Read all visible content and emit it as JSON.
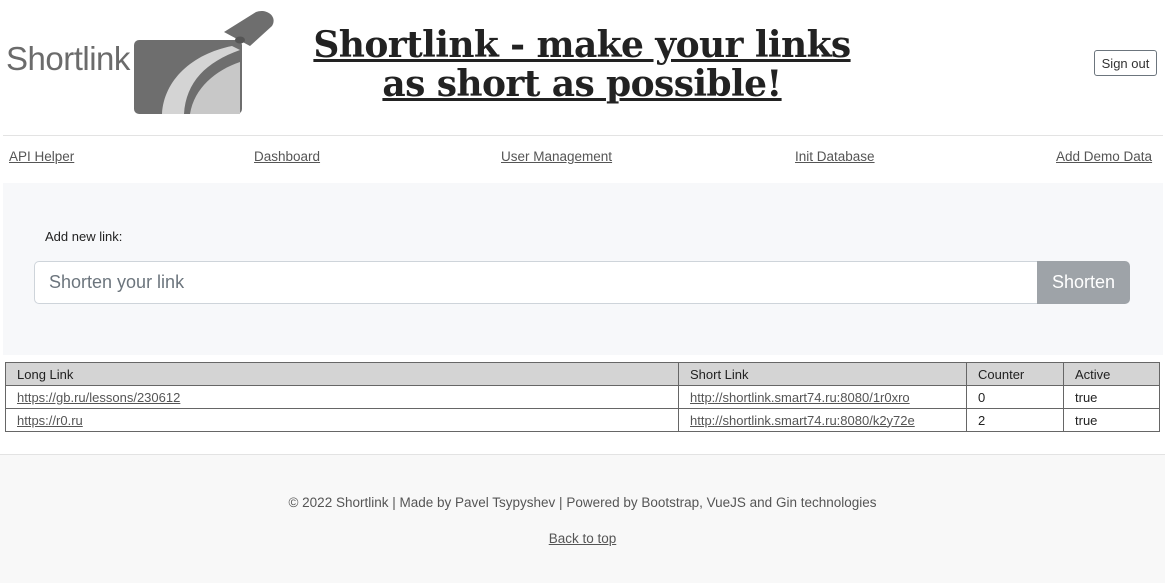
{
  "header": {
    "logo_text": "Shortlink",
    "title": "Shortlink - make your links as short as possible!",
    "signout_label": "Sign out"
  },
  "nav": {
    "items": [
      {
        "label": "API Helper"
      },
      {
        "label": "Dashboard"
      },
      {
        "label": "User Management"
      },
      {
        "label": "Init Database"
      },
      {
        "label": "Add Demo Data"
      }
    ]
  },
  "form": {
    "label": "Add new link:",
    "placeholder": "Shorten your link",
    "button_label": "Shorten"
  },
  "table": {
    "headers": [
      "Long Link",
      "Short Link",
      "Counter",
      "Active"
    ],
    "rows": [
      [
        "https://gb.ru/lessons/230612",
        "http://shortlink.smart74.ru:8080/1r0xro",
        "0",
        "true"
      ],
      [
        "https://r0.ru",
        "http://shortlink.smart74.ru:8080/k2y72e",
        "2",
        "true"
      ]
    ]
  },
  "footer": {
    "text": "© 2022 Shortlink | Made by Pavel Tsypyshev | Powered by Bootstrap, VueJS and Gin technologies",
    "back_to_top": "Back to top"
  }
}
